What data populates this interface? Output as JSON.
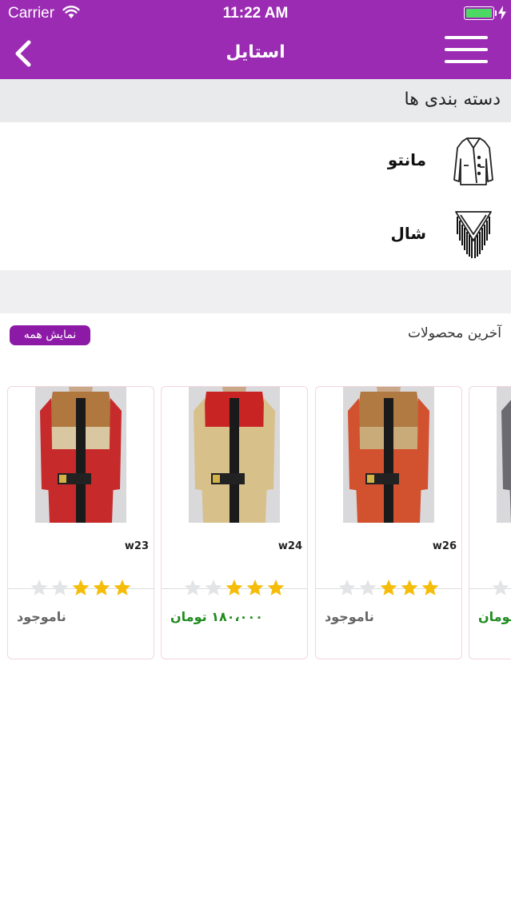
{
  "status_bar": {
    "carrier": "Carrier",
    "time": "11:22 AM",
    "battery_level": 1.0
  },
  "nav": {
    "title": "استایل",
    "back_icon": "chevron-left-icon",
    "menu_icon": "hamburger-menu-icon"
  },
  "categories": {
    "title": "دسته بندی ها",
    "items": [
      {
        "label": "مانتو",
        "icon": "coat-icon"
      },
      {
        "label": "شال",
        "icon": "shawl-icon"
      }
    ]
  },
  "latest": {
    "title": "آخرین محصولات",
    "show_all": "نمایش همه",
    "products": [
      {
        "code": "w23",
        "price": "ناموجود",
        "in_stock": false,
        "rating": 3,
        "colors": [
          "#b0773f",
          "#d8c7a0",
          "#c72a2a"
        ]
      },
      {
        "code": "w24",
        "price": "۱۸۰،۰۰۰ تومان",
        "in_stock": true,
        "rating": 3,
        "colors": [
          "#c92424",
          "#d8c08a",
          "#d8c08a"
        ]
      },
      {
        "code": "w26",
        "price": "ناموجود",
        "in_stock": false,
        "rating": 3,
        "colors": [
          "#b07a42",
          "#c9ab7a",
          "#d2512e"
        ]
      },
      {
        "code": "",
        "price": "تومان",
        "in_stock": true,
        "rating": 3,
        "colors": [
          "#7a7a80",
          "#9a9aa0",
          "#6a6a70"
        ]
      }
    ]
  },
  "colors": {
    "header": "#9b2bb3",
    "show_all_bg": "#8c1aa6",
    "star": "#f5bd0a",
    "star_empty": "#e2e4e6",
    "in_stock": "#1f8c1f"
  }
}
